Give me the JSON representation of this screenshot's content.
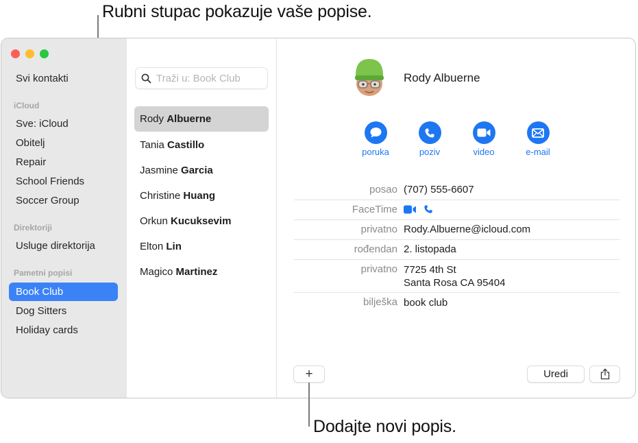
{
  "callouts": {
    "top": "Rubni stupac pokazuje vaše popise.",
    "bottom": "Dodajte novi popis."
  },
  "sidebar": {
    "all_contacts": "Svi kontakti",
    "sections": [
      {
        "title": "iCloud",
        "items": [
          "Sve: iCloud",
          "Obitelj",
          "Repair",
          "School Friends",
          "Soccer Group"
        ]
      },
      {
        "title": "Direktoriji",
        "items": [
          "Usluge direktorija"
        ]
      },
      {
        "title": "Pametni popisi",
        "items": [
          "Book Club",
          "Dog Sitters",
          "Holiday cards"
        ]
      }
    ],
    "selected": "Book Club",
    "accent_color": "#3b82f7"
  },
  "search": {
    "placeholder": "Traži u: Book Club",
    "value": ""
  },
  "contacts": [
    {
      "first": "Rody",
      "last": "Albuerne",
      "selected": true
    },
    {
      "first": "Tania",
      "last": "Castillo"
    },
    {
      "first": "Jasmine",
      "last": "Garcia"
    },
    {
      "first": "Christine",
      "last": "Huang"
    },
    {
      "first": "Orkun",
      "last": "Kucuksevim"
    },
    {
      "first": "Elton",
      "last": "Lin"
    },
    {
      "first": "Magico",
      "last": "Martinez"
    }
  ],
  "detail": {
    "name": "Rody Albuerne",
    "avatar_icon": "memoji-avatar",
    "actions": [
      {
        "label": "poruka",
        "icon": "message-icon"
      },
      {
        "label": "poziv",
        "icon": "phone-icon"
      },
      {
        "label": "video",
        "icon": "video-icon"
      },
      {
        "label": "e-mail",
        "icon": "mail-icon"
      }
    ],
    "fields": [
      {
        "label": "posao",
        "value": "(707) 555-6607"
      },
      {
        "label": "FaceTime",
        "icons": [
          "video-icon",
          "phone-icon"
        ]
      },
      {
        "label": "privatno",
        "value": "Rody.Albuerne@icloud.com"
      },
      {
        "label": "rođendan",
        "value": "2. listopada"
      },
      {
        "label": "privatno",
        "value_line1": "7725 4th St",
        "value_line2": "Santa Rosa CA 95404"
      },
      {
        "label": "bilješka",
        "value": "book club"
      }
    ],
    "action_color": "#1e77f2"
  },
  "toolbar": {
    "add_label": "+",
    "edit_label": "Uredi",
    "share_icon": "share-icon"
  }
}
